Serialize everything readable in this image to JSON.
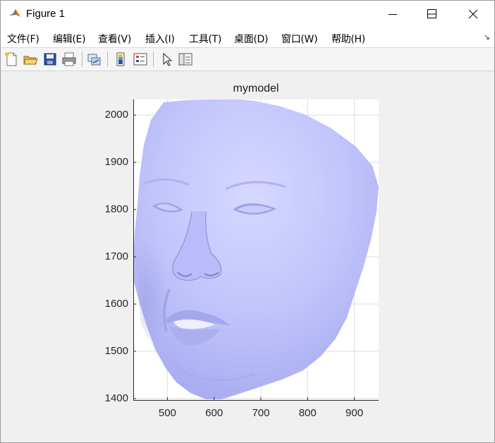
{
  "window": {
    "title": "Figure 1",
    "buttons": {
      "minimize": "minimize",
      "maximize": "maximize",
      "close": "close"
    }
  },
  "menu": {
    "items": [
      {
        "label": "文件(F)"
      },
      {
        "label": "编辑(E)"
      },
      {
        "label": "查看(V)"
      },
      {
        "label": "插入(I)"
      },
      {
        "label": "工具(T)"
      },
      {
        "label": "桌面(D)"
      },
      {
        "label": "窗口(W)"
      },
      {
        "label": "帮助(H)"
      }
    ],
    "overflow_icon": "dock-arrow-icon"
  },
  "toolbar": {
    "icons": [
      "new-figure-icon",
      "open-file-icon",
      "save-icon",
      "print-icon",
      "link-plot-icon",
      "colorbar-icon",
      "legend-icon",
      "select-pointer-icon",
      "property-inspector-icon"
    ]
  },
  "chart_data": {
    "type": "surface",
    "title": "mymodel",
    "xlabel": "",
    "ylabel": "",
    "xlim": [
      427,
      952
    ],
    "ylim": [
      1397,
      2033
    ],
    "x_ticks": [
      "500",
      "600",
      "700",
      "800",
      "900"
    ],
    "y_ticks": [
      "1400",
      "1500",
      "1600",
      "1700",
      "1800",
      "1900",
      "2000"
    ],
    "grid": true,
    "face_color": "#b4b8ff",
    "series": []
  }
}
